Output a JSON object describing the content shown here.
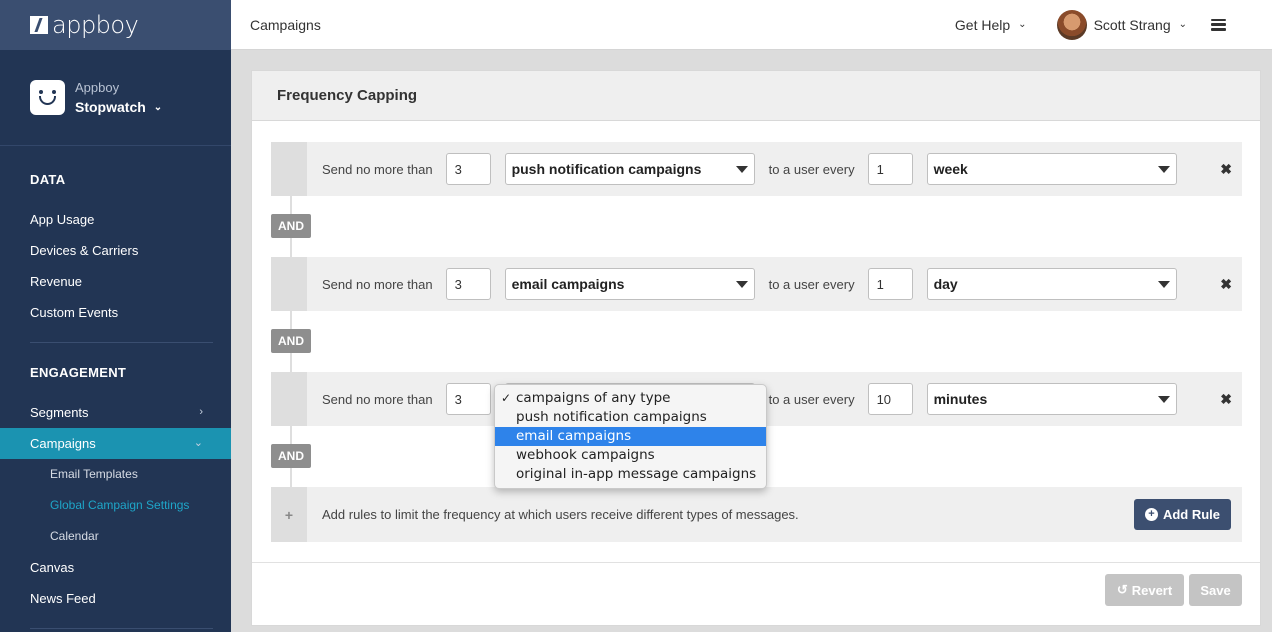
{
  "brand": {
    "logo_text": "appboy"
  },
  "app": {
    "org": "Appboy",
    "name": "Stopwatch"
  },
  "sidebar": {
    "sections": [
      {
        "header": "DATA",
        "items": [
          "App Usage",
          "Devices & Carriers",
          "Revenue",
          "Custom Events"
        ]
      },
      {
        "header": "ENGAGEMENT"
      }
    ],
    "segments": "Segments",
    "campaigns": "Campaigns",
    "sub_items": [
      "Email Templates",
      "Global Campaign Settings",
      "Calendar"
    ],
    "canvas": "Canvas",
    "news_feed": "News Feed"
  },
  "topbar": {
    "title": "Campaigns",
    "help": "Get Help",
    "user": "Scott Strang"
  },
  "panel": {
    "title": "Frequency Capping",
    "prefix_label": "Send no more than",
    "middle_label": "to a user every",
    "and_label": "AND",
    "rules": [
      {
        "count": "3",
        "type": "push notification campaigns",
        "interval": "1",
        "unit": "week"
      },
      {
        "count": "3",
        "type": "email campaigns",
        "interval": "1",
        "unit": "day"
      },
      {
        "count": "3",
        "type": "",
        "interval": "10",
        "unit": "minutes"
      }
    ],
    "add_text": "Add rules to limit the frequency at which users receive different types of messages.",
    "add_button": "Add Rule",
    "revert_button": "Revert",
    "save_button": "Save"
  },
  "dropdown": {
    "options": [
      "campaigns of any type",
      "push notification campaigns",
      "email campaigns",
      "webhook campaigns",
      "original in-app message campaigns"
    ],
    "checked": "campaigns of any type",
    "highlighted": "email campaigns"
  }
}
